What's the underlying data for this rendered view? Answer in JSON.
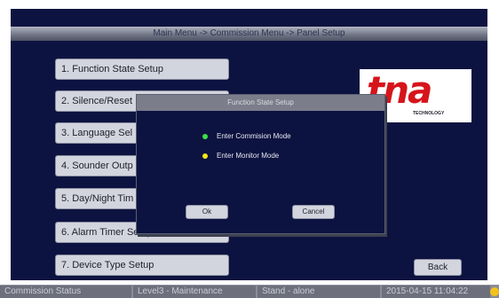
{
  "header": {
    "breadcrumb": "Main Menu -> Commission Menu -> Panel Setup"
  },
  "menu": [
    "1. Function State Setup",
    "2. Silence/Reset",
    "3. Language Sel",
    "4. Sounder Outp",
    "5. Day/Night Tim",
    "6. Alarm Timer Setup",
    "7. Device Type Setup"
  ],
  "logo": {
    "text": "tna",
    "sub": "TECHNOLOGY"
  },
  "back_label": "Back",
  "dialog": {
    "title": "Function State Setup",
    "options": [
      {
        "label": "Enter Commision Mode",
        "color": "#3be04a"
      },
      {
        "label": "Enter Monitor Mode",
        "color": "#f6e51c"
      }
    ],
    "ok_label": "Ok",
    "cancel_label": "Cancel"
  },
  "status": {
    "mode": "Commission Status",
    "level": "Level3 - Maintenance",
    "network": "Stand - alone",
    "datetime": "2015-04-15 11:04:22"
  }
}
